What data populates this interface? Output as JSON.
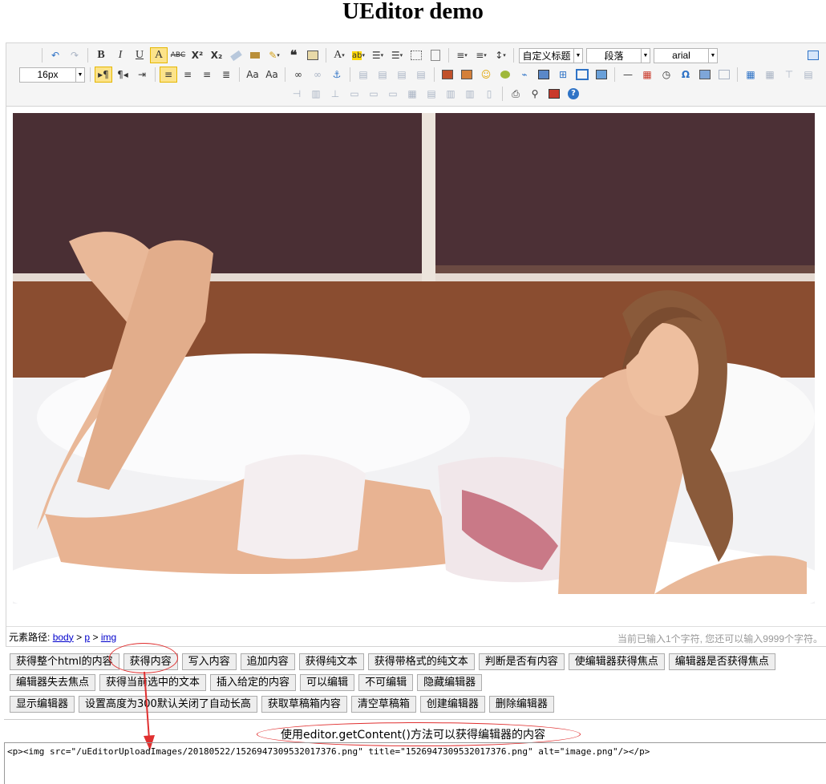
{
  "page": {
    "title": "UEditor demo"
  },
  "toolbar": {
    "font_family": "arial",
    "heading": "自定义标题",
    "paragraph": "段落",
    "font_size": "16px"
  },
  "statusbar": {
    "path_label": "元素路径:",
    "path_items": [
      "body",
      "p",
      "img"
    ],
    "path_sep": ">",
    "word_count": "当前已输入1个字符, 您还可以输入9999个字符。"
  },
  "buttons": {
    "row1": [
      "获得整个html的内容",
      "获得内容",
      "写入内容",
      "追加内容",
      "获得纯文本",
      "获得带格式的纯文本",
      "判断是否有内容",
      "使编辑器获得焦点",
      "编辑器是否获得焦点"
    ],
    "row2": [
      "编辑器失去焦点",
      "获得当前选中的文本",
      "插入给定的内容",
      "可以编辑",
      "不可编辑",
      "隐藏编辑器"
    ],
    "row3": [
      "显示编辑器",
      "设置高度为300默认关闭了自动长高",
      "获取草稿箱内容",
      "清空草稿箱",
      "创建编辑器",
      "删除编辑器"
    ]
  },
  "annotation": {
    "note": "使用editor.getContent()方法可以获得编辑器的内容"
  },
  "output": {
    "code": "<p><img src=\"/uEditorUploadImages/20180522/1526947309532017376.png\" title=\"1526947309532017376.png\" alt=\"image.png\"/></p>"
  },
  "colors": {
    "annotation": "#e03030",
    "link": "#0000cc",
    "active_tool": "#fce38a"
  }
}
